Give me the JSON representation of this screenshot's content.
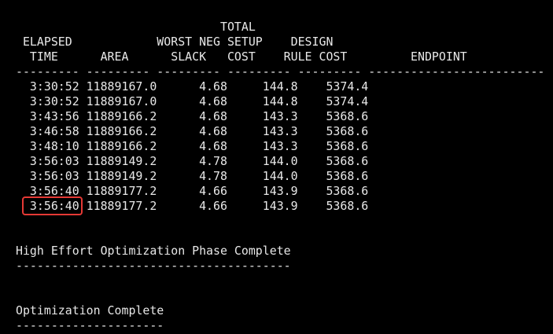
{
  "terminal": {
    "header": [
      "                             TOTAL",
      " ELAPSED            WORST NEG SETUP    DESIGN",
      "  TIME      AREA      SLACK   COST    RULE COST         ENDPOINT",
      "--------- --------- --------- --------- --------- -------------------------"
    ],
    "rows": [
      "  3:30:52 11889167.0      4.68     144.8    5374.4",
      "  3:30:52 11889167.0      4.68     144.8    5374.4",
      "  3:43:56 11889166.2      4.68     143.3    5368.6",
      "  3:46:58 11889166.2      4.68     143.3    5368.6",
      "  3:48:10 11889166.2      4.68     143.3    5368.6",
      "  3:56:03 11889149.2      4.78     144.0    5368.6",
      "  3:56:03 11889149.2      4.78     144.0    5368.6",
      "  3:56:40 11889177.2      4.66     143.9    5368.6",
      "  3:56:40 11889177.2      4.66     143.9    5368.6"
    ],
    "phase_message": "High Effort Optimization Phase Complete",
    "phase_underline": "---------------------------------------",
    "final_message": "Optimization Complete",
    "final_underline": "---------------------"
  },
  "highlight": {
    "label": "3:56:40",
    "color": "#e53935"
  }
}
